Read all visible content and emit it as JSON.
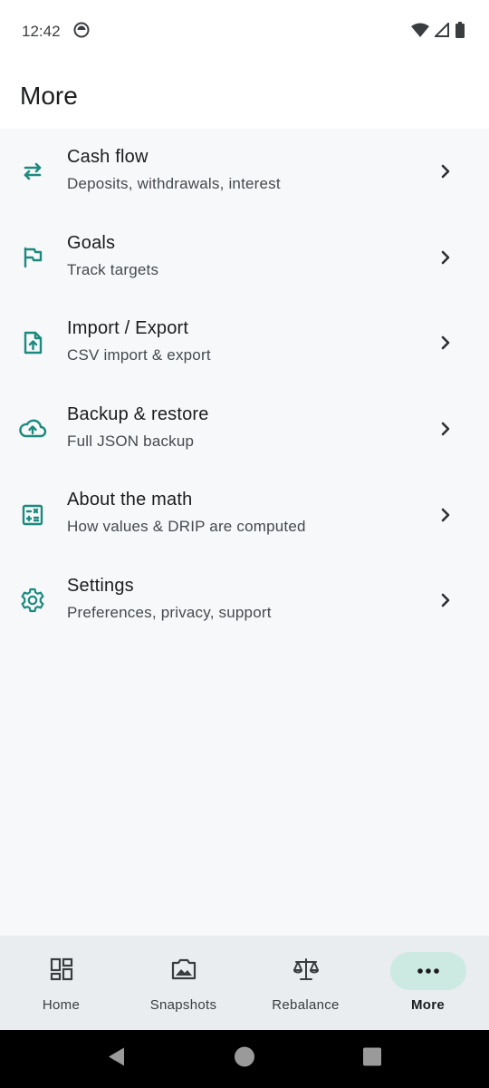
{
  "status_bar": {
    "time": "12:42"
  },
  "app_bar": {
    "title": "More"
  },
  "colors": {
    "accent": "#1c8a7e",
    "nav_active_bg": "#cce9e2",
    "background": "#f6f8fa"
  },
  "menu": {
    "items": [
      {
        "icon": "swap-arrows-icon",
        "title": "Cash flow",
        "subtitle": "Deposits, withdrawals, interest"
      },
      {
        "icon": "flag-icon",
        "title": "Goals",
        "subtitle": "Track targets"
      },
      {
        "icon": "file-upload-icon",
        "title": "Import / Export",
        "subtitle": "CSV import & export"
      },
      {
        "icon": "cloud-upload-icon",
        "title": "Backup & restore",
        "subtitle": "Full JSON backup"
      },
      {
        "icon": "calculator-icon",
        "title": "About the math",
        "subtitle": "How values & DRIP are computed"
      },
      {
        "icon": "gear-icon",
        "title": "Settings",
        "subtitle": "Preferences, privacy, support"
      }
    ]
  },
  "bottom_nav": {
    "items": [
      {
        "icon": "dashboard-icon",
        "label": "Home",
        "active": false
      },
      {
        "icon": "photo-icon",
        "label": "Snapshots",
        "active": false
      },
      {
        "icon": "scale-icon",
        "label": "Rebalance",
        "active": false
      },
      {
        "icon": "more-dots-icon",
        "label": "More",
        "active": true
      }
    ]
  }
}
